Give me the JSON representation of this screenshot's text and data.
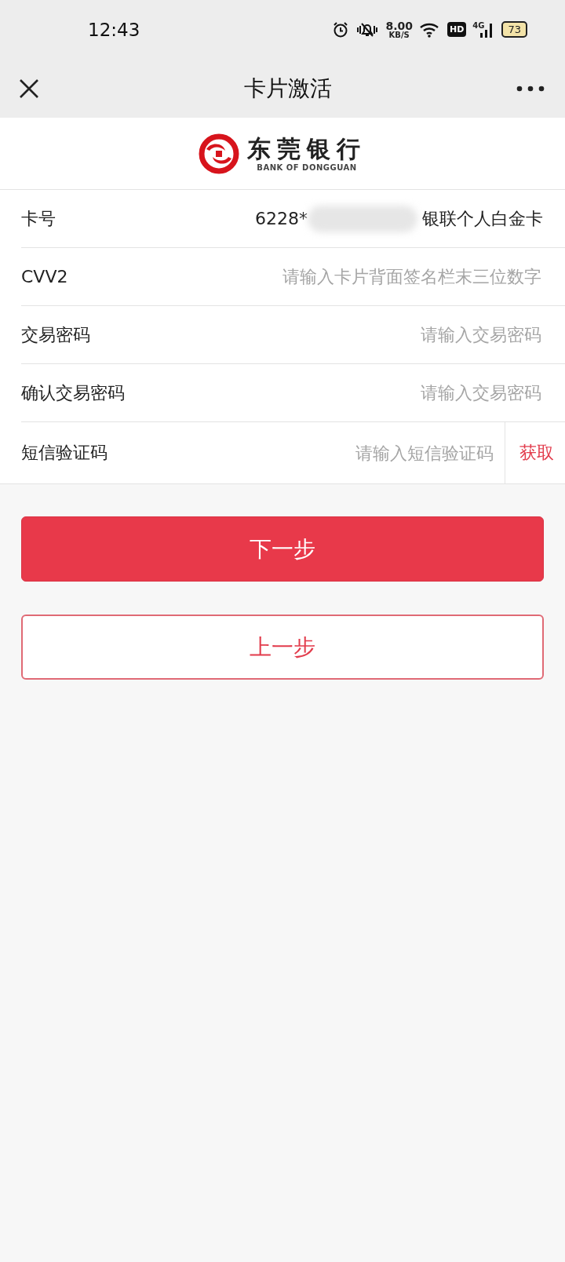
{
  "status_bar": {
    "time": "12:43",
    "net_speed": "8.00",
    "net_unit": "KB/S",
    "hd": "HD",
    "network": "4G",
    "battery": "73"
  },
  "header": {
    "title": "卡片激活"
  },
  "logo": {
    "name": "东莞银行",
    "english": "BANK OF DONGGUAN"
  },
  "fields": [
    {
      "kind": "card",
      "label": "卡号",
      "prefix": "6228*",
      "card_type": "银联个人白金卡"
    },
    {
      "kind": "input",
      "label": "CVV2",
      "placeholder": "请输入卡片背面签名栏末三位数字"
    },
    {
      "kind": "input",
      "label": "交易密码",
      "placeholder": "请输入交易密码"
    },
    {
      "kind": "input",
      "label": "确认交易密码",
      "placeholder": "请输入交易密码"
    },
    {
      "kind": "sms",
      "label": "短信验证码",
      "placeholder": "请输入短信验证码",
      "action": "获取"
    }
  ],
  "buttons": [
    {
      "kind": "primary",
      "label": "下一步"
    },
    {
      "kind": "secondary",
      "label": "上一步"
    }
  ]
}
